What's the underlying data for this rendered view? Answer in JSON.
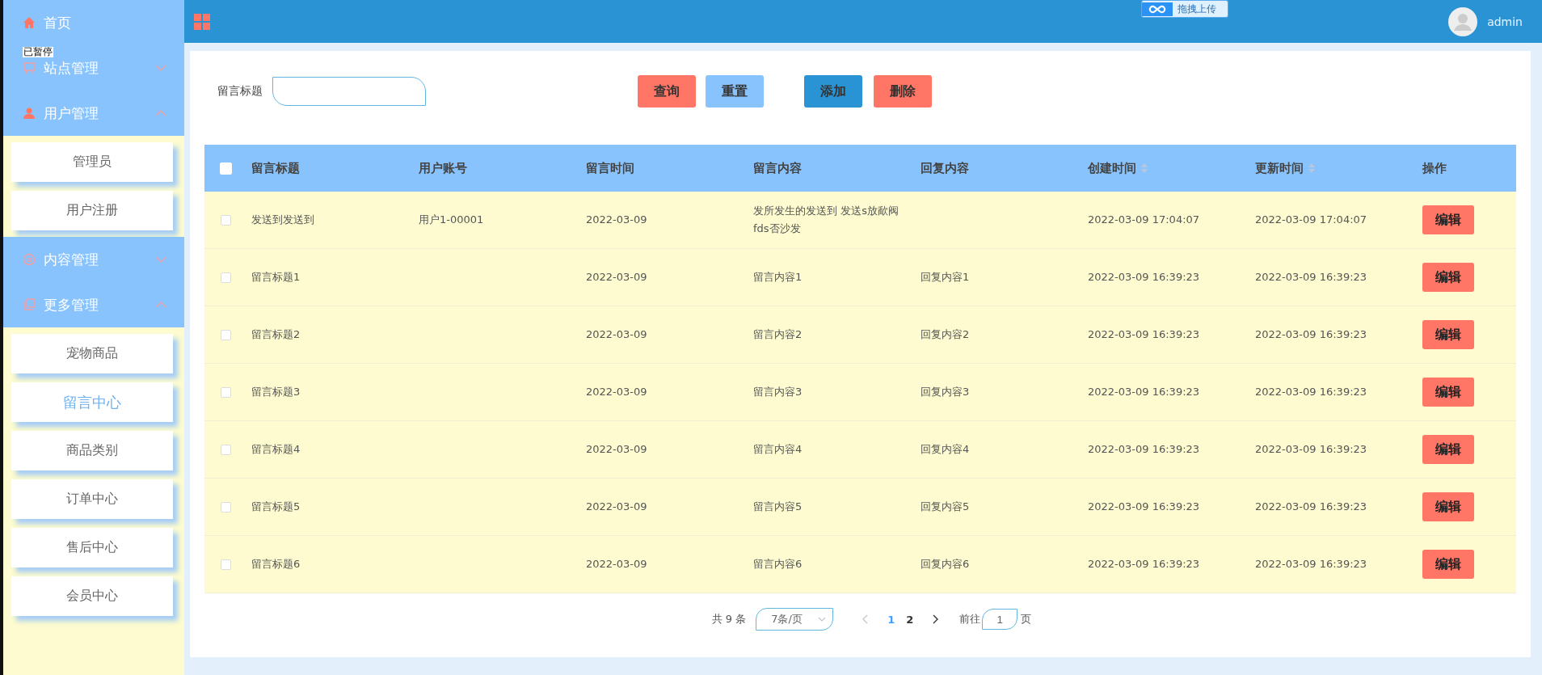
{
  "overlays": {
    "recorder_badge": "已暂停",
    "upload_widget": "拖拽上传"
  },
  "sidebar": {
    "items": [
      {
        "label": "首页",
        "kind": "link"
      },
      {
        "label": "站点管理",
        "kind": "group",
        "expanded": false
      },
      {
        "label": "用户管理",
        "kind": "group",
        "expanded": true,
        "children": [
          {
            "label": "管理员",
            "selected": false
          },
          {
            "label": "用户注册",
            "selected": false
          }
        ]
      },
      {
        "label": "内容管理",
        "kind": "group",
        "expanded": false
      },
      {
        "label": "更多管理",
        "kind": "group",
        "expanded": true,
        "children": [
          {
            "label": "宠物商品",
            "selected": false
          },
          {
            "label": "留言中心",
            "selected": true
          },
          {
            "label": "商品类别",
            "selected": false
          },
          {
            "label": "订单中心",
            "selected": false
          },
          {
            "label": "售后中心",
            "selected": false
          },
          {
            "label": "会员中心",
            "selected": false
          }
        ]
      }
    ]
  },
  "topbar": {
    "user": "admin"
  },
  "search": {
    "label": "留言标题"
  },
  "buttons": [
    {
      "label": "查询",
      "kind": "query"
    },
    {
      "label": "重置",
      "kind": "reset"
    },
    {
      "label": "添加",
      "kind": "add"
    },
    {
      "label": "删除",
      "kind": "delete"
    }
  ],
  "table": {
    "select_all": false,
    "columns": [
      {
        "label": "留言标题",
        "sortable": false
      },
      {
        "label": "用户账号",
        "sortable": false
      },
      {
        "label": "留言时间",
        "sortable": false
      },
      {
        "label": "留言内容",
        "sortable": false
      },
      {
        "label": "回复内容",
        "sortable": false
      },
      {
        "label": "创建时间",
        "sortable": true
      },
      {
        "label": "更新时间",
        "sortable": true
      },
      {
        "label": "操作",
        "sortable": false
      }
    ],
    "rows": [
      {
        "checked": false,
        "cells": [
          "发送到发送到",
          "用户1-00001",
          "2022-03-09",
          "发所发生的发送到 发送s放歃阀 fds否沙发",
          "",
          "2022-03-09 17:04:07",
          "2022-03-09 17:04:07"
        ],
        "action": "编辑"
      },
      {
        "checked": false,
        "cells": [
          "留言标题1",
          "",
          "2022-03-09",
          "留言内容1",
          "回复内容1",
          "2022-03-09 16:39:23",
          "2022-03-09 16:39:23"
        ],
        "action": "编辑"
      },
      {
        "checked": false,
        "cells": [
          "留言标题2",
          "",
          "2022-03-09",
          "留言内容2",
          "回复内容2",
          "2022-03-09 16:39:23",
          "2022-03-09 16:39:23"
        ],
        "action": "编辑"
      },
      {
        "checked": false,
        "cells": [
          "留言标题3",
          "",
          "2022-03-09",
          "留言内容3",
          "回复内容3",
          "2022-03-09 16:39:23",
          "2022-03-09 16:39:23"
        ],
        "action": "编辑"
      },
      {
        "checked": false,
        "cells": [
          "留言标题4",
          "",
          "2022-03-09",
          "留言内容4",
          "回复内容4",
          "2022-03-09 16:39:23",
          "2022-03-09 16:39:23"
        ],
        "action": "编辑"
      },
      {
        "checked": false,
        "cells": [
          "留言标题5",
          "",
          "2022-03-09",
          "留言内容5",
          "回复内容5",
          "2022-03-09 16:39:23",
          "2022-03-09 16:39:23"
        ],
        "action": "编辑"
      },
      {
        "checked": false,
        "cells": [
          "留言标题6",
          "",
          "2022-03-09",
          "留言内容6",
          "回复内容6",
          "2022-03-09 16:39:23",
          "2022-03-09 16:39:23"
        ],
        "action": "编辑"
      }
    ]
  },
  "pagination": {
    "total": "共 9 条",
    "page_size": "7条/页",
    "prev_disabled": true,
    "pages": [
      {
        "label": "1",
        "selected": true
      },
      {
        "label": "2",
        "selected": false
      }
    ],
    "goto_label": "前往",
    "goto_value": "1",
    "goto_suffix": "页"
  }
}
